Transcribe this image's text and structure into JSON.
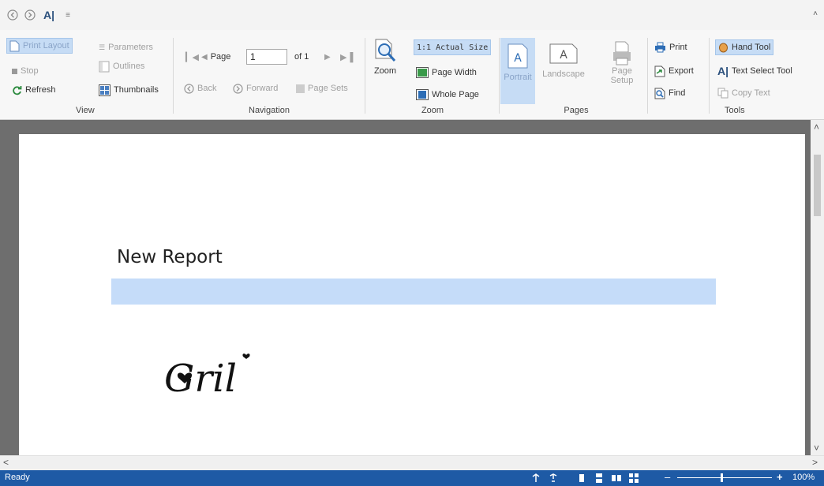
{
  "qat": {
    "items": [
      "back-icon",
      "forward-icon",
      "text-select-icon",
      "customize-icon"
    ],
    "text_select_glyph": "A|",
    "customize_glyph": "≡",
    "collapse_glyph": "˄"
  },
  "ribbon": {
    "view": {
      "label": "View",
      "print_layout": "Print Layout",
      "parameters": "Parameters",
      "stop": "Stop",
      "outlines": "Outlines",
      "refresh": "Refresh",
      "thumbnails": "Thumbnails"
    },
    "navigation": {
      "label": "Navigation",
      "page_label": "Page",
      "page_value": "1",
      "of_label": "of 1",
      "back": "Back",
      "forward": "Forward",
      "page_sets": "Page Sets"
    },
    "zoom": {
      "label": "Zoom",
      "zoom": "Zoom",
      "actual_size": "1:1 Actual Size",
      "page_width": "Page Width",
      "whole_page": "Whole Page"
    },
    "pages": {
      "label": "Pages",
      "portrait": "Portrait",
      "landscape": "Landscape",
      "page_setup_line1": "Page",
      "page_setup_line2": "Setup"
    },
    "output": {
      "print": "Print",
      "export": "Export",
      "find": "Find"
    },
    "tools": {
      "label": "Tools",
      "hand_tool": "Hand Tool",
      "text_select_tool": "Text Select Tool",
      "text_select_glyph": "A|",
      "copy_text": "Copy Text"
    }
  },
  "document": {
    "title": "New Report",
    "signature_text": "Gril"
  },
  "scroll": {
    "left_arrow": "<",
    "right_arrow": ">",
    "up_arrow": "˄",
    "down_arrow": "˅"
  },
  "status": {
    "text": "Ready",
    "zoom_minus": "–",
    "zoom_plus": "+",
    "zoom_level": "100%"
  },
  "colors": {
    "selected": "#c6dcf5",
    "status_bar": "#1e5aa5",
    "band": "#c5dcf9",
    "doc_background": "#6e6e6e"
  }
}
